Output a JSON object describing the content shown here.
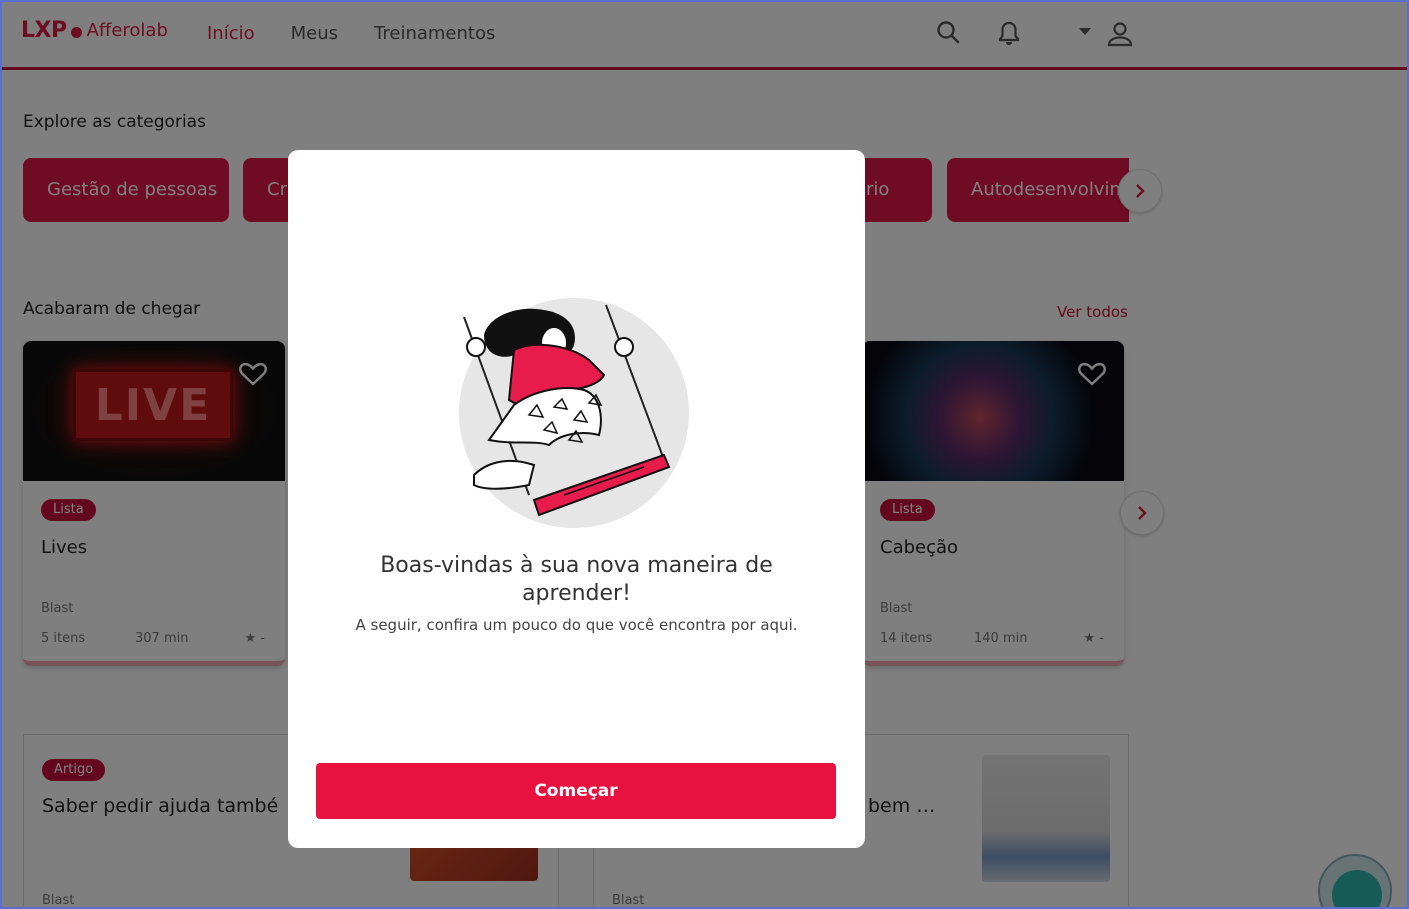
{
  "header": {
    "logo_lxp": "LXP",
    "logo_brand": "Afferolab",
    "nav": [
      "Início",
      "Meus",
      "Treinamentos"
    ]
  },
  "categories": {
    "title": "Explore as categorias",
    "items": [
      "Gestão de pessoas",
      "Cr",
      "rio",
      "Autodesenvolvim"
    ]
  },
  "recent": {
    "title": "Acabaram de chegar",
    "see_all": "Ver todos",
    "cards": [
      {
        "badge": "Lista",
        "title": "Lives",
        "source": "Blast",
        "items": "5 itens",
        "duration": "307 min",
        "rating": "★ -",
        "image_text": "LIVE"
      },
      {
        "badge": "Lista",
        "title": "Cabeção",
        "source": "Blast",
        "items": "14 itens",
        "duration": "140 min",
        "rating": "★ -"
      }
    ]
  },
  "articles": [
    {
      "badge": "Artigo",
      "title": "Saber pedir ajuda també",
      "source": "Blast"
    },
    {
      "title": "bem …",
      "source": "Blast"
    }
  ],
  "modal": {
    "title": "Boas-vindas à sua nova maneira de aprender!",
    "subtitle": "A seguir, confira um pouco do que você encontra por aqui.",
    "button": "Começar"
  },
  "colors": {
    "accent": "#e0164a",
    "header_border": "#c8103e"
  }
}
